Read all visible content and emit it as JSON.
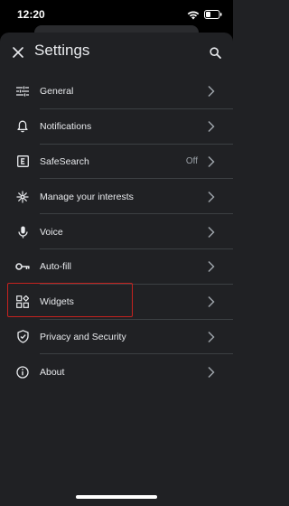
{
  "status": {
    "time": "12:20"
  },
  "header": {
    "title": "Settings"
  },
  "menu": {
    "items": [
      {
        "label": "General",
        "value": ""
      },
      {
        "label": "Notifications",
        "value": ""
      },
      {
        "label": "SafeSearch",
        "value": "Off"
      },
      {
        "label": "Manage your interests",
        "value": ""
      },
      {
        "label": "Voice",
        "value": ""
      },
      {
        "label": "Auto-fill",
        "value": ""
      },
      {
        "label": "Widgets",
        "value": ""
      },
      {
        "label": "Privacy and Security",
        "value": ""
      },
      {
        "label": "About",
        "value": ""
      }
    ]
  },
  "colors": {
    "background": "#202124",
    "text": "#e8eaed",
    "secondary_text": "#9aa0a6",
    "divider": "#3c4043",
    "highlight_outline": "#c5221f"
  },
  "icons": {
    "close": "close-icon",
    "search": "search-icon",
    "general": "sliders-icon",
    "notifications": "bell-icon",
    "safesearch": "explicit-e-icon",
    "interests": "sparkle-icon",
    "voice": "microphone-icon",
    "autofill": "key-icon",
    "widgets": "widgets-icon",
    "privacy": "shield-check-icon",
    "about": "info-icon"
  },
  "highlighted_item": "Widgets"
}
